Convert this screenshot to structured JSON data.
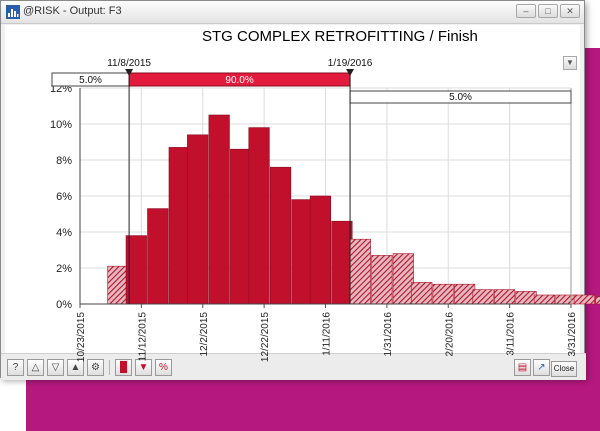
{
  "window": {
    "title": "@RISK - Output: F3",
    "buttons": [
      "–",
      "□",
      "✕"
    ]
  },
  "toolbar": {
    "close_label": "Close"
  },
  "icons": {
    "app": "histogram-app-icon",
    "toolbar_left": [
      "help-icon",
      "triangle-up-icon",
      "triangle-down-icon",
      "triangle-mountain-icon",
      "gear-icon",
      "histogram-icon",
      "funnel-icon",
      "percent-icon"
    ],
    "toolbar_right": [
      "report-icon",
      "export-icon"
    ]
  },
  "colors": {
    "bar": "#c0102c",
    "bar_tail": "#a9182d",
    "marker_band": "#e21b3c",
    "background": "#b5187f"
  },
  "chart_data": {
    "type": "bar",
    "title": "STG COMPLEX RETROFITTING / Finish",
    "xlabel": "",
    "ylabel": "",
    "x_tick_labels": [
      "10/23/2015",
      "11/12/2015",
      "12/2/2015",
      "12/22/2015",
      "1/11/2016",
      "1/31/2016",
      "2/20/2016",
      "3/11/2016",
      "3/31/2016"
    ],
    "x_range": [
      "10/23/2015",
      "3/31/2016"
    ],
    "y_tick_labels": [
      "0%",
      "2%",
      "4%",
      "6%",
      "8%",
      "10%",
      "12%"
    ],
    "ylim": [
      0,
      12
    ],
    "grid": true,
    "bin_days": 6.7,
    "bins": [
      {
        "start": "11/1/2015",
        "value": 2.1
      },
      {
        "start": "11/7/2015",
        "value": 3.8
      },
      {
        "start": "11/14/2015",
        "value": 5.3
      },
      {
        "start": "11/21/2015",
        "value": 8.7
      },
      {
        "start": "11/27/2015",
        "value": 9.4
      },
      {
        "start": "12/4/2015",
        "value": 10.5
      },
      {
        "start": "12/11/2015",
        "value": 8.6
      },
      {
        "start": "12/17/2015",
        "value": 9.8
      },
      {
        "start": "12/24/2015",
        "value": 7.6
      },
      {
        "start": "12/31/2015",
        "value": 5.8
      },
      {
        "start": "1/6/2016",
        "value": 6.0
      },
      {
        "start": "1/13/2016",
        "value": 4.6
      },
      {
        "start": "1/19/2016",
        "value": 3.6
      },
      {
        "start": "1/26/2016",
        "value": 2.7
      },
      {
        "start": "2/2/2016",
        "value": 2.8
      },
      {
        "start": "2/8/2016",
        "value": 1.2
      },
      {
        "start": "2/15/2016",
        "value": 1.1
      },
      {
        "start": "2/22/2016",
        "value": 1.1
      },
      {
        "start": "2/28/2016",
        "value": 0.8
      },
      {
        "start": "3/6/2016",
        "value": 0.8
      },
      {
        "start": "3/13/2016",
        "value": 0.7
      },
      {
        "start": "3/19/2016",
        "value": 0.5
      },
      {
        "start": "3/26/2016",
        "value": 0.5
      },
      {
        "start": "4/1/2016",
        "value": 0.5
      },
      {
        "start": "4/8/2016",
        "value": 0.4
      }
    ],
    "delimiters": [
      {
        "date": "11/8/2015",
        "label": "11/8/2015"
      },
      {
        "date": "1/19/2016",
        "label": "1/19/2016"
      }
    ],
    "probabilities": {
      "left": "5.0%",
      "middle": "90.0%",
      "right": "5.0%"
    }
  }
}
